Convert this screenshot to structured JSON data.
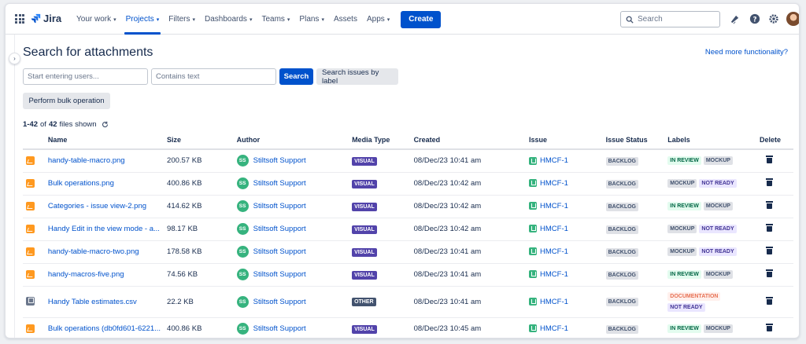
{
  "nav": {
    "logo": "Jira",
    "items": [
      {
        "label": "Your work",
        "caret": true
      },
      {
        "label": "Projects",
        "caret": true,
        "active": true
      },
      {
        "label": "Filters",
        "caret": true
      },
      {
        "label": "Dashboards",
        "caret": true
      },
      {
        "label": "Teams",
        "caret": true
      },
      {
        "label": "Plans",
        "caret": true
      },
      {
        "label": "Assets",
        "caret": false
      },
      {
        "label": "Apps",
        "caret": true
      }
    ],
    "create_label": "Create",
    "search_placeholder": "Search"
  },
  "page": {
    "title": "Search for attachments",
    "more_link": "Need more functionality?",
    "users_placeholder": "Start entering users...",
    "text_placeholder": "Contains text",
    "search_button": "Search",
    "label_button": "Search issues by label",
    "bulk_button": "Perform bulk operation",
    "count_from": "1-42",
    "count_of": "of",
    "count_total": "42",
    "count_suffix": "files shown"
  },
  "table": {
    "headers": [
      "Name",
      "Size",
      "Author",
      "Media Type",
      "Created",
      "Issue",
      "Issue Status",
      "Labels",
      "Delete"
    ],
    "rows": [
      {
        "icon": "image",
        "name": "handy-table-macro.png",
        "size": "200.57 KB",
        "author_initials": "SS",
        "author": "Stiltsoft Support",
        "media": "VISUAL",
        "created": "08/Dec/23 10:41 am",
        "issue": "HMCF-1",
        "status": "BACKLOG",
        "labels": [
          "IN REVIEW",
          "MOCKUP"
        ]
      },
      {
        "icon": "image",
        "name": "Bulk operations.png",
        "size": "400.86 KB",
        "author_initials": "SS",
        "author": "Stiltsoft Support",
        "media": "VISUAL",
        "created": "08/Dec/23 10:42 am",
        "issue": "HMCF-1",
        "status": "BACKLOG",
        "labels": [
          "MOCKUP",
          "NOT READY"
        ]
      },
      {
        "icon": "image",
        "name": "Categories - issue view-2.png",
        "size": "414.62 KB",
        "author_initials": "SS",
        "author": "Stiltsoft Support",
        "media": "VISUAL",
        "created": "08/Dec/23 10:42 am",
        "issue": "HMCF-1",
        "status": "BACKLOG",
        "labels": [
          "IN REVIEW",
          "MOCKUP"
        ]
      },
      {
        "icon": "image",
        "name": "Handy Edit in the view mode - a...",
        "size": "98.17 KB",
        "author_initials": "SS",
        "author": "Stiltsoft Support",
        "media": "VISUAL",
        "created": "08/Dec/23 10:42 am",
        "issue": "HMCF-1",
        "status": "BACKLOG",
        "labels": [
          "MOCKUP",
          "NOT READY"
        ]
      },
      {
        "icon": "image",
        "name": "handy-table-macro-two.png",
        "size": "178.58 KB",
        "author_initials": "SS",
        "author": "Stiltsoft Support",
        "media": "VISUAL",
        "created": "08/Dec/23 10:41 am",
        "issue": "HMCF-1",
        "status": "BACKLOG",
        "labels": [
          "MOCKUP",
          "NOT READY"
        ]
      },
      {
        "icon": "image",
        "name": "handy-macros-five.png",
        "size": "74.56 KB",
        "author_initials": "SS",
        "author": "Stiltsoft Support",
        "media": "VISUAL",
        "created": "08/Dec/23 10:41 am",
        "issue": "HMCF-1",
        "status": "BACKLOG",
        "labels": [
          "IN REVIEW",
          "MOCKUP"
        ]
      },
      {
        "icon": "doc",
        "name": "Handy Table estimates.csv",
        "size": "22.2 KB",
        "author_initials": "SS",
        "author": "Stiltsoft Support",
        "media": "OTHER",
        "created": "08/Dec/23 10:41 am",
        "issue": "HMCF-1",
        "status": "BACKLOG",
        "labels": [
          "DOCUMENTATION",
          "NOT READY"
        ]
      },
      {
        "icon": "image",
        "name": "Bulk operations (db0fd601-6221...",
        "size": "400.86 KB",
        "author_initials": "SS",
        "author": "Stiltsoft Support",
        "media": "VISUAL",
        "created": "08/Dec/23 10:45 am",
        "issue": "HMCF-1",
        "status": "BACKLOG",
        "labels": [
          "IN REVIEW",
          "MOCKUP"
        ]
      }
    ]
  },
  "colors": {
    "primary": "#0052cc",
    "visual": "#5243aa",
    "other": "#42526e",
    "success": "#36b37e"
  }
}
